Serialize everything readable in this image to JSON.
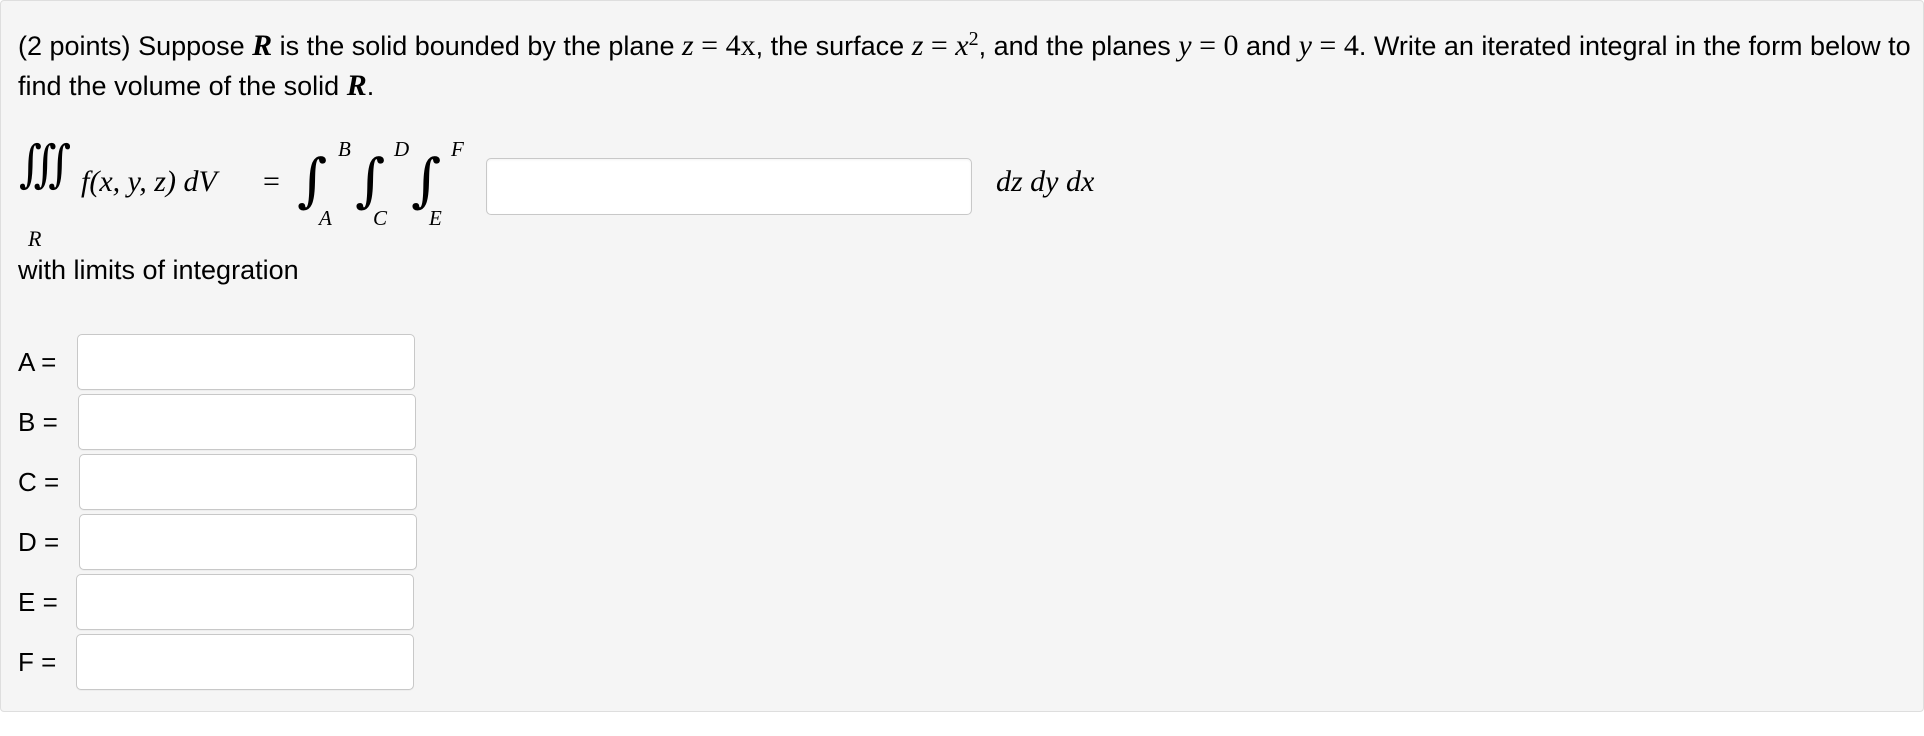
{
  "problem": {
    "points": "(2 points)",
    "t1": " Suppose ",
    "R": "R",
    "t2": " is the solid bounded by the plane ",
    "plane_lhs": "z",
    "eq": " = ",
    "plane_rhs": "4x",
    "t3": ", the surface ",
    "surface_lhs": "z",
    "surface_rhs_base": "x",
    "surface_rhs_exp": "2",
    "t4": ", and the planes ",
    "y1_lhs": "y",
    "y1_rhs": "0",
    "t5": " and ",
    "y2_lhs": "y",
    "y2_rhs": "4",
    "t6": ". Write an iterated integral in the form below to find the volume of the solid ",
    "R2": "R",
    "t7": "."
  },
  "integral": {
    "triple_symbol": "∭",
    "region": "R",
    "lhs": "f(x, y, z) dV",
    "equals": "=",
    "int_symbol": "∫",
    "upper_limits": [
      "B",
      "D",
      "F"
    ],
    "lower_limits": [
      "A",
      "C",
      "E"
    ],
    "integrand_value": "",
    "differentials": "dz dy dx"
  },
  "with_limits_text": "with limits of integration",
  "limits": [
    {
      "label": "A =",
      "value": ""
    },
    {
      "label": "B =",
      "value": ""
    },
    {
      "label": "C =",
      "value": ""
    },
    {
      "label": "D =",
      "value": ""
    },
    {
      "label": "E =",
      "value": ""
    },
    {
      "label": "F =",
      "value": ""
    }
  ]
}
